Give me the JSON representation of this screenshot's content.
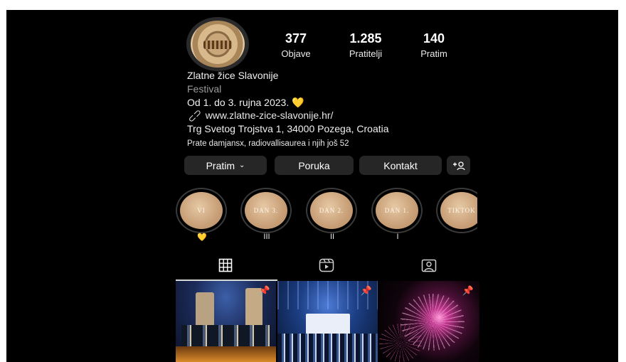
{
  "profile": {
    "stats": [
      {
        "value": "377",
        "label": "Objave"
      },
      {
        "value": "1.285",
        "label": "Pratitelji"
      },
      {
        "value": "140",
        "label": "Pratim"
      }
    ],
    "name": "Zlatne žice Slavonije",
    "category": "Festival",
    "bio_line": "Od 1. do 3. rujna 2023.",
    "bio_emoji": "💛",
    "link_icon": "link-icon",
    "website": "www.zlatne-zice-slavonije.hr/",
    "address": "Trg Svetog Trojstva 1, 34000 Pozega, Croatia",
    "followed_by": "Prate damjansx, radiovallisaurea i njih još 52"
  },
  "buttons": {
    "follow": "Pratim",
    "message": "Poruka",
    "contact": "Kontakt",
    "add_user_icon": "add-person-icon"
  },
  "highlights": [
    {
      "cover_text": "VI",
      "label": "💛"
    },
    {
      "cover_text": "DAN 3.",
      "label": "III"
    },
    {
      "cover_text": "DAN 2.",
      "label": "II"
    },
    {
      "cover_text": "DAN 1.",
      "label": "I"
    },
    {
      "cover_text": "TIKTOK",
      "label": ""
    }
  ],
  "tabs": [
    {
      "icon": "grid-icon"
    },
    {
      "icon": "reels-icon"
    },
    {
      "icon": "tagged-icon"
    }
  ],
  "colors": {
    "background": "#000000",
    "button": "#262626",
    "heart": "#f5c518"
  }
}
